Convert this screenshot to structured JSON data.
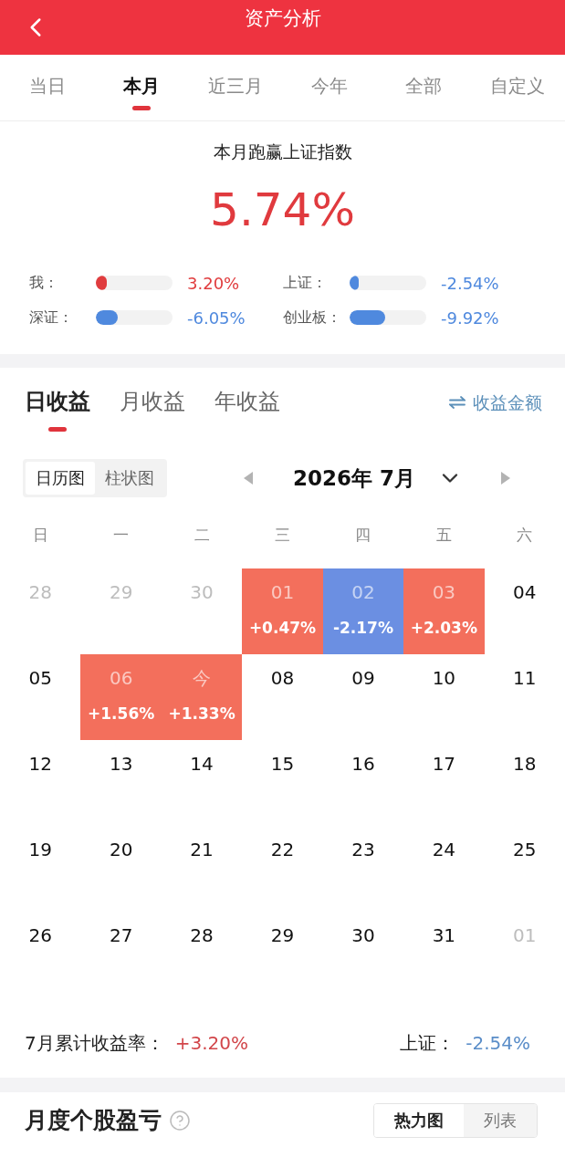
{
  "header": {
    "title": "资产分析"
  },
  "period_tabs": [
    {
      "label": "当日",
      "selected": false
    },
    {
      "label": "本月",
      "selected": true
    },
    {
      "label": "近三月",
      "selected": false
    },
    {
      "label": "今年",
      "selected": false
    },
    {
      "label": "全部",
      "selected": false
    },
    {
      "label": "自定义",
      "selected": false
    }
  ],
  "summary": {
    "title": "本月跑赢上证指数",
    "value": "5.74%",
    "compare": [
      {
        "label": "我：",
        "level": 0.14,
        "value": "3.20%",
        "color": "#e03c3e"
      },
      {
        "label": "上证：",
        "level": 0.12,
        "value": "-2.54%",
        "color": "#4f89de"
      },
      {
        "label": "深证：",
        "level": 0.29,
        "value": "-6.05%",
        "color": "#4f89de"
      },
      {
        "label": "创业板：",
        "level": 0.46,
        "value": "-9.92%",
        "color": "#4f89de"
      }
    ]
  },
  "returns": {
    "tabs": [
      {
        "label": "日收益",
        "selected": true
      },
      {
        "label": "月收益",
        "selected": false
      },
      {
        "label": "年收益",
        "selected": false
      }
    ],
    "switch_label": "收益金额",
    "view_toggle": [
      {
        "label": "日历图",
        "selected": true
      },
      {
        "label": "柱状图",
        "selected": false
      }
    ],
    "month": "2026年 7月",
    "weekdays": [
      "日",
      "一",
      "二",
      "三",
      "四",
      "五",
      "六"
    ],
    "weeks": [
      [
        {
          "day": "28",
          "in_month": false
        },
        {
          "day": "29",
          "in_month": false
        },
        {
          "day": "30",
          "in_month": false
        },
        {
          "day": "01",
          "in_month": true,
          "color": "#f36f5c",
          "change": "+0.47%"
        },
        {
          "day": "02",
          "in_month": true,
          "color": "#6b8fe2",
          "change": "-2.17%"
        },
        {
          "day": "03",
          "in_month": true,
          "color": "#f36f5c",
          "change": "+2.03%"
        },
        {
          "day": "04",
          "in_month": true
        }
      ],
      [
        {
          "day": "05",
          "in_month": true
        },
        {
          "day": "06",
          "in_month": true,
          "color": "#f36f5c",
          "change": "+1.56%"
        },
        {
          "day": "今",
          "in_month": true,
          "color": "#f36f5c",
          "change": "+1.33%"
        },
        {
          "day": "08",
          "in_month": true
        },
        {
          "day": "09",
          "in_month": true
        },
        {
          "day": "10",
          "in_month": true
        },
        {
          "day": "11",
          "in_month": true
        }
      ],
      [
        {
          "day": "12",
          "in_month": true
        },
        {
          "day": "13",
          "in_month": true
        },
        {
          "day": "14",
          "in_month": true
        },
        {
          "day": "15",
          "in_month": true
        },
        {
          "day": "16",
          "in_month": true
        },
        {
          "day": "17",
          "in_month": true
        },
        {
          "day": "18",
          "in_month": true
        }
      ],
      [
        {
          "day": "19",
          "in_month": true
        },
        {
          "day": "20",
          "in_month": true
        },
        {
          "day": "21",
          "in_month": true
        },
        {
          "day": "22",
          "in_month": true
        },
        {
          "day": "23",
          "in_month": true
        },
        {
          "day": "24",
          "in_month": true
        },
        {
          "day": "25",
          "in_month": true
        }
      ],
      [
        {
          "day": "26",
          "in_month": true
        },
        {
          "day": "27",
          "in_month": true
        },
        {
          "day": "28",
          "in_month": true
        },
        {
          "day": "29",
          "in_month": true
        },
        {
          "day": "30",
          "in_month": true
        },
        {
          "day": "31",
          "in_month": true
        },
        {
          "day": "01",
          "in_month": false
        }
      ]
    ],
    "cumulative": {
      "label": "7月累计收益率：",
      "value": "+3.20%",
      "color": "#d2464a"
    },
    "index": {
      "label": "上证：",
      "value": "-2.54%",
      "color": "#5a8dc8"
    }
  },
  "stock_pnl": {
    "title": "月度个股盈亏",
    "view_toggle": [
      {
        "label": "热力图",
        "selected": true
      },
      {
        "label": "列表",
        "selected": false
      }
    ]
  }
}
